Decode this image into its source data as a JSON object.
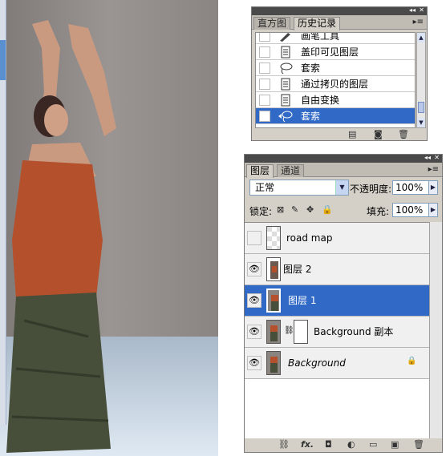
{
  "history_panel": {
    "tabs": [
      {
        "label": "直方图",
        "active": false
      },
      {
        "label": "历史记录",
        "active": true
      }
    ],
    "items": [
      {
        "label": "画笔工具",
        "icon": "brush-icon",
        "selected": false
      },
      {
        "label": "盖印可见图层",
        "icon": "document-icon",
        "selected": false
      },
      {
        "label": "套索",
        "icon": "lasso-icon",
        "selected": false
      },
      {
        "label": "通过拷贝的图层",
        "icon": "document-icon",
        "selected": false
      },
      {
        "label": "自由变换",
        "icon": "document-icon",
        "selected": false
      },
      {
        "label": "套索",
        "icon": "lasso-icon",
        "selected": true
      }
    ],
    "footer_icons": [
      "new-document-from-state-icon",
      "snapshot-camera-icon",
      "trash-icon"
    ]
  },
  "layers_panel": {
    "tabs": [
      {
        "label": "图层",
        "active": true
      },
      {
        "label": "通道",
        "active": false
      }
    ],
    "blend_mode": "正常",
    "opacity_label": "不透明度:",
    "opacity_value": "100%",
    "lock_label": "锁定:",
    "fill_label": "填充:",
    "fill_value": "100%",
    "layers": [
      {
        "name": "road map",
        "visible": false,
        "selected": false,
        "italic": false,
        "locked": false
      },
      {
        "name": "图层 2",
        "visible": true,
        "selected": false,
        "italic": false,
        "locked": false
      },
      {
        "name": "图层 1",
        "visible": true,
        "selected": true,
        "italic": false,
        "locked": false
      },
      {
        "name": "Background 副本",
        "visible": true,
        "selected": false,
        "italic": false,
        "locked": false
      },
      {
        "name": "Background",
        "visible": true,
        "selected": false,
        "italic": true,
        "locked": true
      }
    ],
    "footer_icons": [
      "link-icon",
      "fx-icon",
      "mask-icon",
      "adjustment-icon",
      "folder-icon",
      "new-layer-icon",
      "trash-icon"
    ]
  },
  "colors": {
    "selection_blue": "#3169c6",
    "panel_gray": "#d4d0c8",
    "title_dark": "#4a4a4a"
  }
}
